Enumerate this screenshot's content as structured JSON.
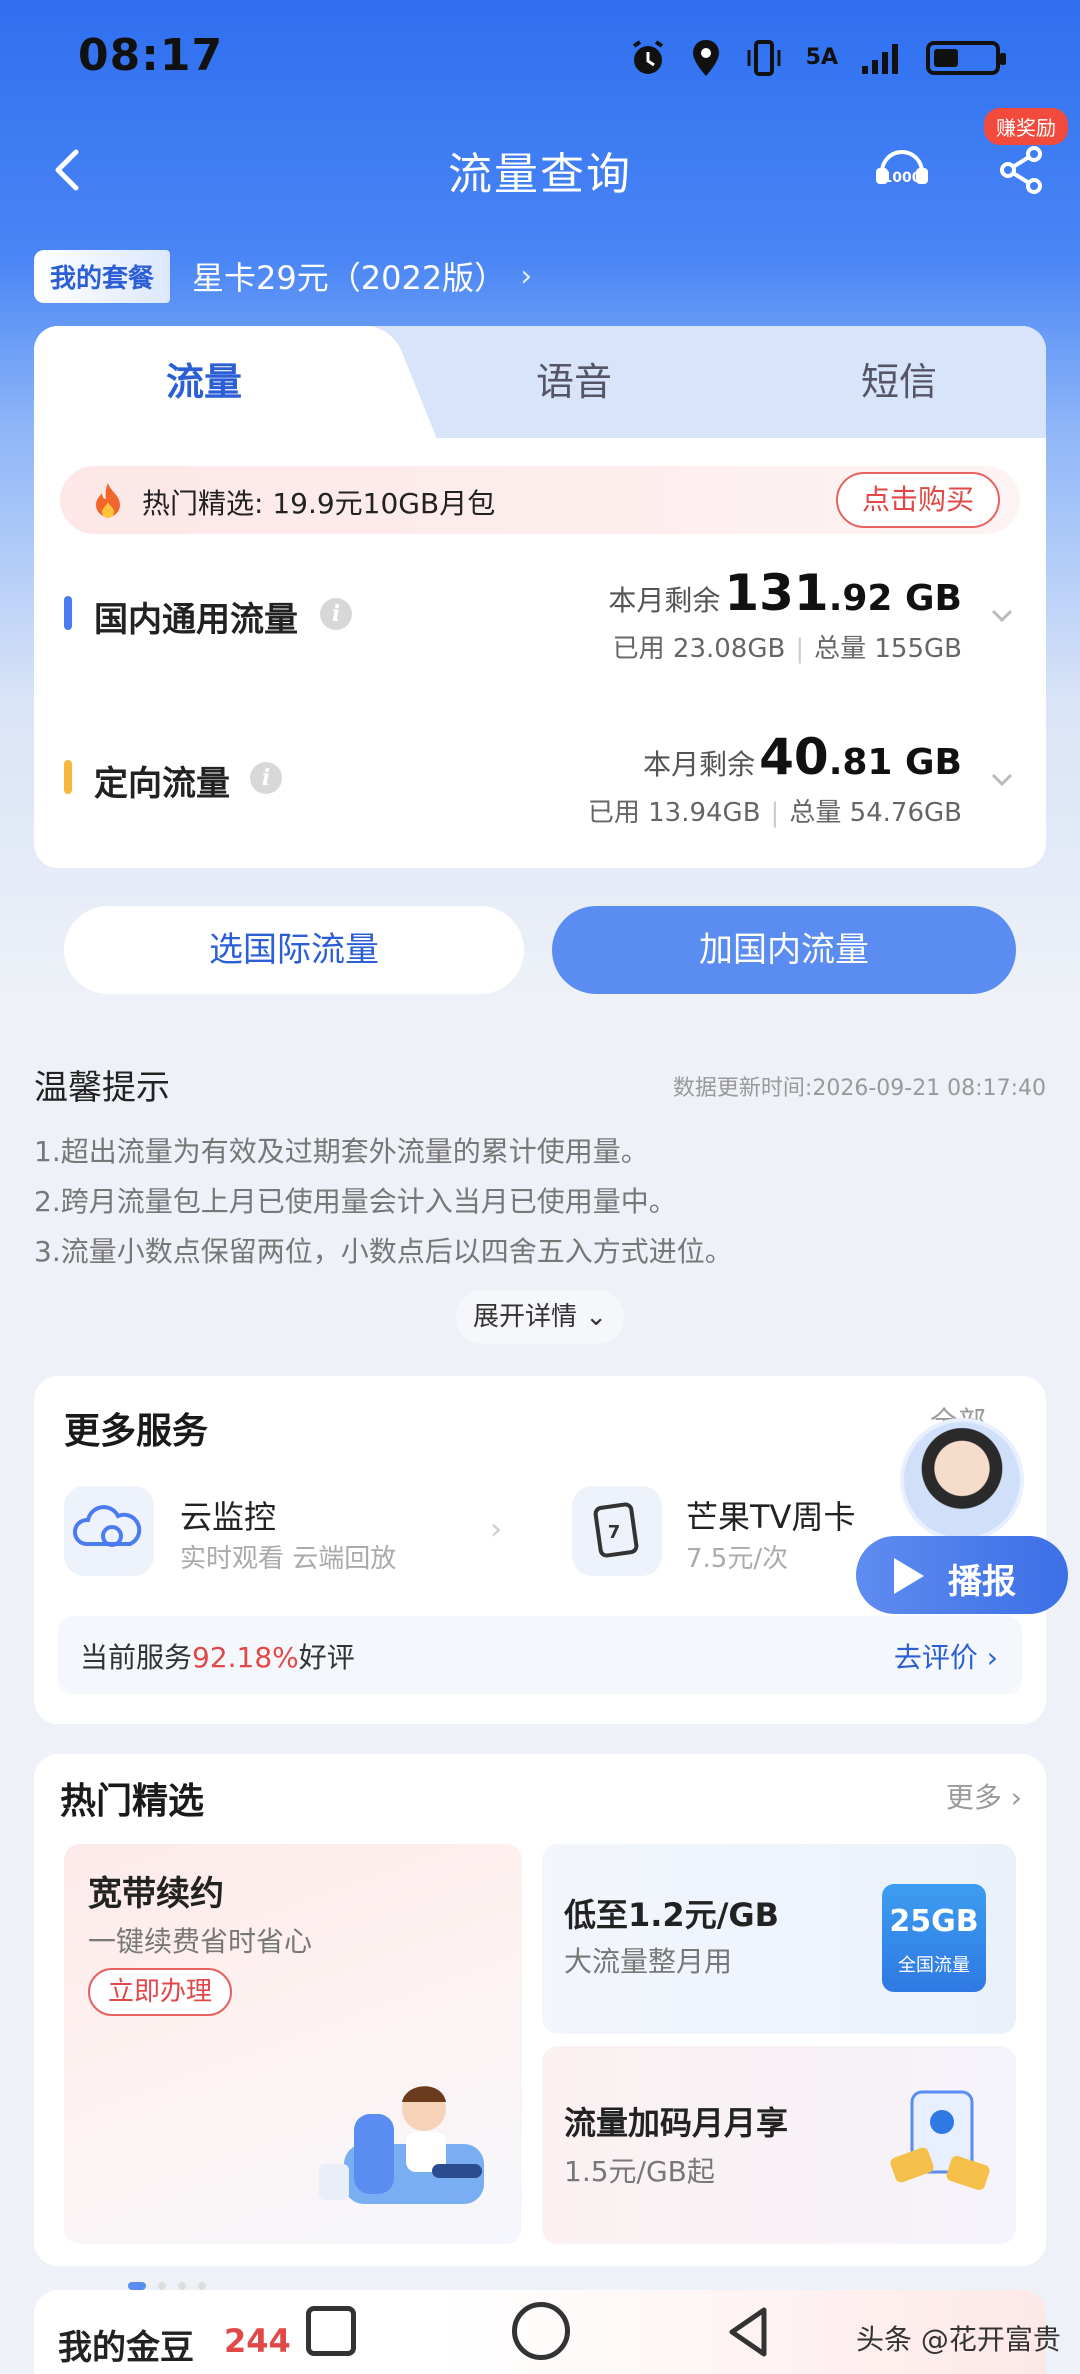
{
  "status_bar": {
    "time": "08:17",
    "network": "5A"
  },
  "nav": {
    "title": "流量查询",
    "reward_badge": "赚奖励"
  },
  "plan": {
    "tag": "我的套餐",
    "name": "星卡29元（2022版）"
  },
  "tabs": [
    {
      "label": "流量"
    },
    {
      "label": "语音"
    },
    {
      "label": "短信"
    }
  ],
  "promo": {
    "text": "热门精选: 19.9元10GB月包",
    "button": "点击购买"
  },
  "usage": [
    {
      "name": "国内通用流量",
      "color": "#4a7cf0",
      "remain_label": "本月剩余",
      "remain_int": "131",
      "remain_dec": ".92 GB",
      "used": "已用 23.08GB",
      "total": "总量 155GB"
    },
    {
      "name": "定向流量",
      "color": "#f5b83d",
      "remain_label": "本月剩余",
      "remain_int": "40",
      "remain_dec": ".81 GB",
      "used": "已用 13.94GB",
      "total": "总量 54.76GB"
    }
  ],
  "actions": {
    "intl": "选国际流量",
    "domestic": "加国内流量"
  },
  "tips": {
    "title": "温馨提示",
    "update_time": "数据更新时间:2026-09-21 08:17:40",
    "lines": [
      "1.超出流量为有效及过期套外流量的累计使用量。",
      "2.跨月流量包上月已使用量会计入当月已使用量中。",
      "3.流量小数点保留两位，小数点后以四舍五入方式进位。"
    ],
    "expand": "展开详情"
  },
  "services": {
    "title": "更多服务",
    "all": "全部",
    "items": [
      {
        "name": "云监控",
        "sub": "实时观看 云端回放",
        "icon": "cloud-camera-icon"
      },
      {
        "name": "芒果TV周卡",
        "sub": "7.5元/次",
        "icon": "tv-card-icon"
      }
    ],
    "rating_prefix": "当前服务",
    "rating_pct": "92.18%",
    "rating_suffix": "好评",
    "rating_link": "去评价"
  },
  "assistant": {
    "label": "播报"
  },
  "hot": {
    "title": "热门精选",
    "more": "更多",
    "left": {
      "title": "宽带续约",
      "sub": "一键续费省时省心",
      "button": "立即办理"
    },
    "right_top": {
      "title": "低至1.2元/GB",
      "sub": "大流量整月用",
      "badge_big": "25GB",
      "badge_small": "全国流量"
    },
    "right_bottom": {
      "title": "流量加码月月享",
      "sub": "1.5元/GB起"
    }
  },
  "gold": {
    "label": "我的金豆",
    "value": "244"
  },
  "watermark": "头条 @花开富贵"
}
